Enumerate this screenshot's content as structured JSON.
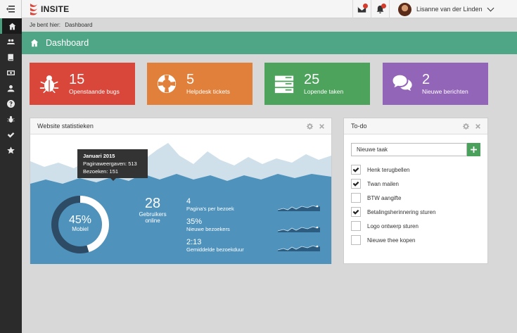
{
  "header": {
    "logo_text": "INSITE",
    "user_name": "Lisanne van der Linden",
    "mail_badge": "",
    "notif_badge": ""
  },
  "breadcrumb": {
    "prefix": "Je bent hier:",
    "current": "Dashboard"
  },
  "page": {
    "title": "Dashboard"
  },
  "sidebar": {
    "items": [
      "home-icon",
      "users-icon",
      "book-icon",
      "money-icon",
      "user-icon",
      "question-icon",
      "bug-icon",
      "check-icon",
      "star-icon"
    ]
  },
  "tiles": [
    {
      "number": "15",
      "label": "Openstaande bugs",
      "color": "#d9473b",
      "icon": "bug-icon"
    },
    {
      "number": "5",
      "label": "Helpdesk tickets",
      "color": "#e0803a",
      "icon": "lifebuoy-icon"
    },
    {
      "number": "25",
      "label": "Lopende taken",
      "color": "#4da35c",
      "icon": "server-icon"
    },
    {
      "number": "2",
      "label": "Nieuwe berichten",
      "color": "#9265b8",
      "icon": "chat-icon"
    }
  ],
  "stats": {
    "title": "Website statistieken",
    "tooltip": {
      "title": "Januari 2015",
      "line1": "Paginaweergaven: 513",
      "line2": "Bezoeken: 151"
    },
    "donut": {
      "value": "45%",
      "label": "Mobiel",
      "fraction": 0.45
    },
    "users": {
      "value": "28",
      "label1": "Gebruikers",
      "label2": "online"
    },
    "metrics": [
      {
        "value": "4",
        "label": "Pagina's per bezoek"
      },
      {
        "value": "35%",
        "label": "Nieuwe bezoekers"
      },
      {
        "value": "2:13",
        "label": "Gemiddelde bezoekduur"
      }
    ],
    "colors": {
      "wave": "#4f93bd",
      "donut_bg": "#2e4b66",
      "donut_fg": "#ffffff"
    }
  },
  "todo": {
    "title": "To-do",
    "placeholder": "Nieuwe taak",
    "items": [
      {
        "text": "Henk terugbellen",
        "checked": true
      },
      {
        "text": "Twan mailen",
        "checked": true
      },
      {
        "text": "BTW aangifte",
        "checked": false
      },
      {
        "text": "Betalingsherinnering sturen",
        "checked": true
      },
      {
        "text": "Logo ontwerp sturen",
        "checked": false
      },
      {
        "text": "Nieuwe thee kopen",
        "checked": false
      }
    ]
  }
}
